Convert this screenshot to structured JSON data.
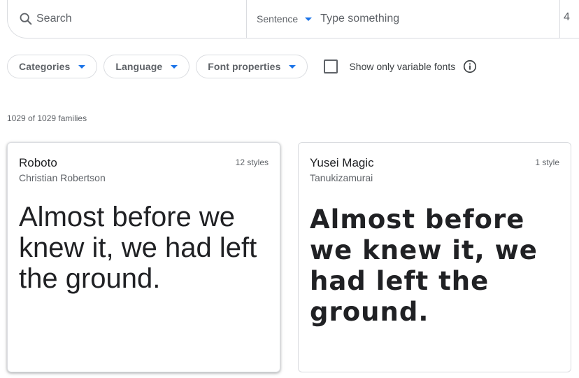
{
  "search": {
    "placeholder": "Search"
  },
  "preview": {
    "mode_label": "Sentence",
    "placeholder": "Type something"
  },
  "filters": {
    "chips": [
      {
        "label": "Categories"
      },
      {
        "label": "Language"
      },
      {
        "label": "Font properties"
      }
    ],
    "variable_toggle": {
      "label": "Show only variable fonts",
      "checked": false
    }
  },
  "results": {
    "count_text": "1029 of 1029 families"
  },
  "cards": [
    {
      "name": "Roboto",
      "author": "Christian Robertson",
      "styles": "12 styles",
      "sample": "Almost before we knew it, we had left the ground."
    },
    {
      "name": "Yusei Magic",
      "author": "Tanukizamurai",
      "styles": "1 style",
      "sample": "Almost before we knew it, we had left the ground."
    }
  ],
  "colors": {
    "accent": "#1a73e8",
    "border": "#dadce0",
    "text_primary": "#202124",
    "text_secondary": "#5f6368"
  },
  "icons": {
    "search": "search-icon",
    "dropdown": "caret-down-icon",
    "info": "info-icon"
  }
}
